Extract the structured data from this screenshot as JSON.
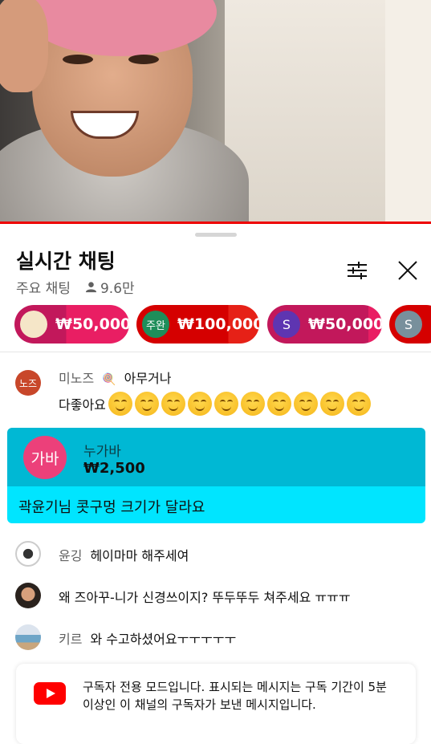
{
  "chat": {
    "title": "실시간 채팅",
    "mode": "주요 채팅",
    "viewers": "9.6만"
  },
  "tickers": [
    {
      "avatar_text": "",
      "amount": "₩50,000"
    },
    {
      "avatar_text": "주완",
      "amount": "₩100,000"
    },
    {
      "avatar_text": "S",
      "amount": "₩50,000"
    },
    {
      "avatar_text": "S",
      "amount": ""
    }
  ],
  "messages": [
    {
      "avatar_text": "노즈",
      "name": "미노즈",
      "text": "아무거나",
      "text2": "다좋아요",
      "emoji_count": 10
    },
    {
      "name": "윤깅",
      "text": "헤이마마 해주세여"
    },
    {
      "name": "",
      "text": "왜 즈아꾸-니가 신경쓰이지?  뚜두뚜두 쳐주세요 ㅠㅠㅠ"
    },
    {
      "name": "키르",
      "text": "와 수고하셨어요ㅜㅜㅜㅜㅜ"
    }
  ],
  "superchat": {
    "avatar_text": "가바",
    "name": "누가바",
    "amount": "₩2,500",
    "message": "곽윤기님 콧구멍 크기가 달라요"
  },
  "notice": {
    "text": "구독자 전용 모드입니다. 표시되는 메시지는 구독 기간이 5분 이상인 이 채널의 구독자가 보낸 메시지입니다."
  },
  "colors": {
    "accent_red": "#ff0000",
    "superchat_top": "#00b8d4",
    "superchat_bottom": "#00e5ff",
    "ticker_pink": "#e91e63",
    "ticker_red": "#e62117"
  }
}
